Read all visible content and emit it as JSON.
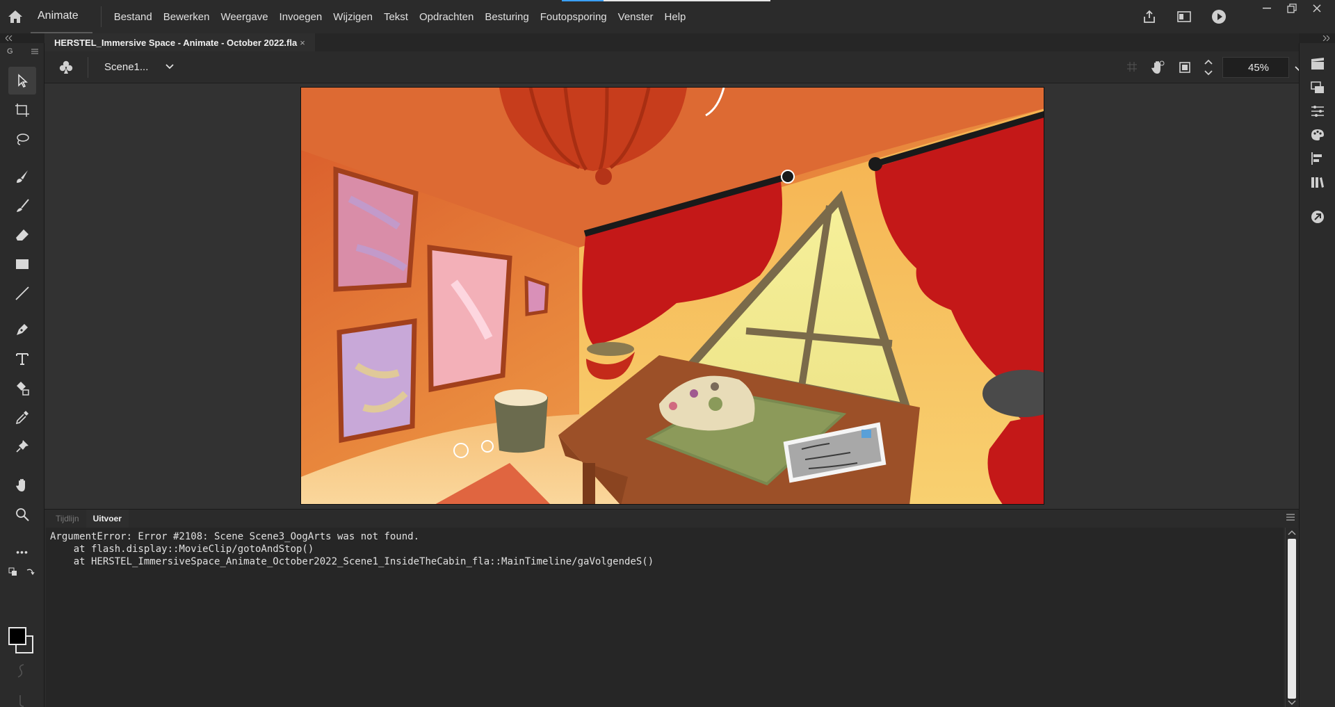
{
  "app": {
    "name": "Animate",
    "menus": [
      "Bestand",
      "Bewerken",
      "Weergave",
      "Invoegen",
      "Wijzigen",
      "Tekst",
      "Opdrachten",
      "Besturing",
      "Foutopsporing",
      "Venster",
      "Help"
    ]
  },
  "document": {
    "tab_title": "HERSTEL_Immersive Space - Animate - October 2022.fla",
    "close_glyph": "×"
  },
  "toolbar": {
    "header_label": "G",
    "more_label": "•••"
  },
  "stage": {
    "scene_label": "Scene1...",
    "zoom": "45%"
  },
  "bottom_panel": {
    "tabs": [
      "Tijdlijn",
      "Uitvoer"
    ],
    "active_tab": "Uitvoer",
    "output_lines": [
      "ArgumentError: Error #2108: Scene Scene3_OogArts was not found.",
      "    at flash.display::MovieClip/gotoAndStop()",
      "    at HERSTEL_ImmersiveSpace_Animate_October2022_Scene1_InsideTheCabin_fla::MainTimeline/gaVolgendeS()"
    ]
  },
  "colors": {
    "accent": "#3aa0ff",
    "chrome_bg": "#2b2b2b",
    "stage_bg": "#323232"
  }
}
